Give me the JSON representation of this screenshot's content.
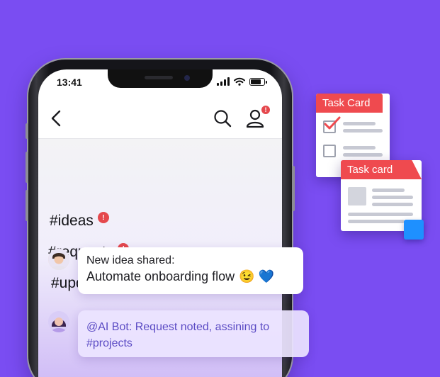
{
  "status_bar": {
    "time": "13:41"
  },
  "nav": {
    "notification_count": "!"
  },
  "channels": [
    {
      "name": "#ideas",
      "badge": "!"
    },
    {
      "name": "#requests",
      "badge": "!"
    },
    {
      "name": "#updates",
      "badge": "!"
    }
  ],
  "messages": [
    {
      "line1": "New idea shared:",
      "line2": "Automate onboarding flow",
      "emoji": "😉 💙"
    },
    {
      "text": "@AI Bot: Request noted, assining to #projects"
    }
  ],
  "task_cards": [
    {
      "title": "Task Card"
    },
    {
      "title": "Task card"
    }
  ],
  "colors": {
    "background": "#7a4df2",
    "badge": "#e5484d",
    "task_card_header": "#ef4a4f",
    "bot_text": "#5b4bc4",
    "accent_square": "#1e90ff"
  }
}
